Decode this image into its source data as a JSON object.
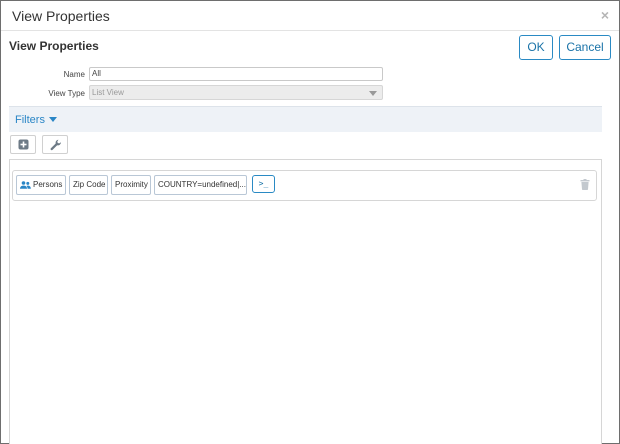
{
  "dialog": {
    "title": "View Properties",
    "close_icon": "close-icon"
  },
  "header": {
    "heading": "View Properties",
    "ok_label": "OK",
    "cancel_label": "Cancel"
  },
  "form": {
    "name_label": "Name",
    "name_value": "All",
    "view_type_label": "View Type",
    "view_type_value": "List View"
  },
  "filters": {
    "label": "Filters",
    "toolbar": [
      "add-icon",
      "wrench-icon"
    ],
    "row": {
      "chips": {
        "persons": "Persons",
        "zip": "Zip Code",
        "proximity": "Proximity",
        "country": "COUNTRY=undefined|..."
      },
      "console_label": ">_",
      "delete_icon": "trash-icon"
    }
  },
  "colors": {
    "accent": "#2a8ac4",
    "filters_bar_bg": "#eef2f7",
    "border": "#d6d6d6"
  }
}
